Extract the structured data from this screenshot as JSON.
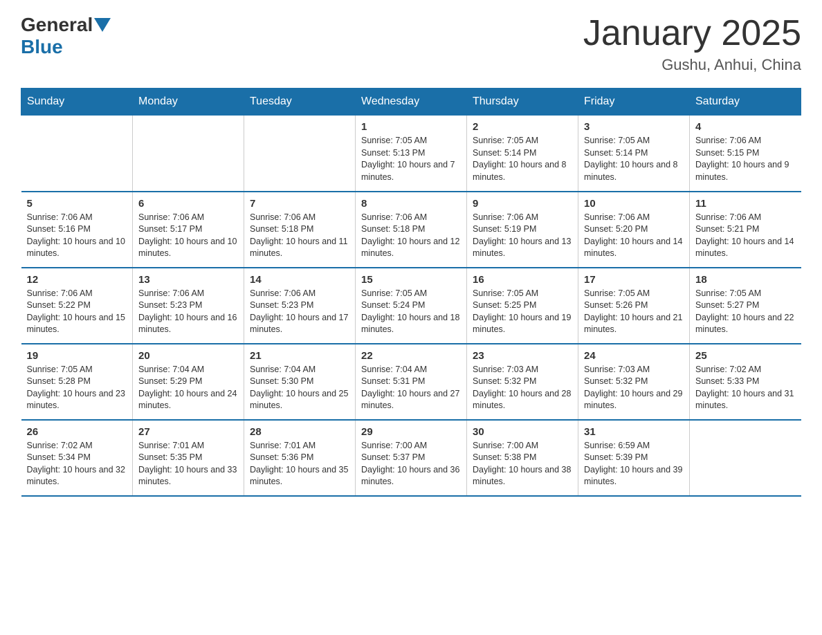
{
  "header": {
    "logo_general": "General",
    "logo_blue": "Blue",
    "month_title": "January 2025",
    "location": "Gushu, Anhui, China"
  },
  "days_of_week": [
    "Sunday",
    "Monday",
    "Tuesday",
    "Wednesday",
    "Thursday",
    "Friday",
    "Saturday"
  ],
  "weeks": [
    [
      {
        "day": "",
        "info": ""
      },
      {
        "day": "",
        "info": ""
      },
      {
        "day": "",
        "info": ""
      },
      {
        "day": "1",
        "info": "Sunrise: 7:05 AM\nSunset: 5:13 PM\nDaylight: 10 hours and 7 minutes."
      },
      {
        "day": "2",
        "info": "Sunrise: 7:05 AM\nSunset: 5:14 PM\nDaylight: 10 hours and 8 minutes."
      },
      {
        "day": "3",
        "info": "Sunrise: 7:05 AM\nSunset: 5:14 PM\nDaylight: 10 hours and 8 minutes."
      },
      {
        "day": "4",
        "info": "Sunrise: 7:06 AM\nSunset: 5:15 PM\nDaylight: 10 hours and 9 minutes."
      }
    ],
    [
      {
        "day": "5",
        "info": "Sunrise: 7:06 AM\nSunset: 5:16 PM\nDaylight: 10 hours and 10 minutes."
      },
      {
        "day": "6",
        "info": "Sunrise: 7:06 AM\nSunset: 5:17 PM\nDaylight: 10 hours and 10 minutes."
      },
      {
        "day": "7",
        "info": "Sunrise: 7:06 AM\nSunset: 5:18 PM\nDaylight: 10 hours and 11 minutes."
      },
      {
        "day": "8",
        "info": "Sunrise: 7:06 AM\nSunset: 5:18 PM\nDaylight: 10 hours and 12 minutes."
      },
      {
        "day": "9",
        "info": "Sunrise: 7:06 AM\nSunset: 5:19 PM\nDaylight: 10 hours and 13 minutes."
      },
      {
        "day": "10",
        "info": "Sunrise: 7:06 AM\nSunset: 5:20 PM\nDaylight: 10 hours and 14 minutes."
      },
      {
        "day": "11",
        "info": "Sunrise: 7:06 AM\nSunset: 5:21 PM\nDaylight: 10 hours and 14 minutes."
      }
    ],
    [
      {
        "day": "12",
        "info": "Sunrise: 7:06 AM\nSunset: 5:22 PM\nDaylight: 10 hours and 15 minutes."
      },
      {
        "day": "13",
        "info": "Sunrise: 7:06 AM\nSunset: 5:23 PM\nDaylight: 10 hours and 16 minutes."
      },
      {
        "day": "14",
        "info": "Sunrise: 7:06 AM\nSunset: 5:23 PM\nDaylight: 10 hours and 17 minutes."
      },
      {
        "day": "15",
        "info": "Sunrise: 7:05 AM\nSunset: 5:24 PM\nDaylight: 10 hours and 18 minutes."
      },
      {
        "day": "16",
        "info": "Sunrise: 7:05 AM\nSunset: 5:25 PM\nDaylight: 10 hours and 19 minutes."
      },
      {
        "day": "17",
        "info": "Sunrise: 7:05 AM\nSunset: 5:26 PM\nDaylight: 10 hours and 21 minutes."
      },
      {
        "day": "18",
        "info": "Sunrise: 7:05 AM\nSunset: 5:27 PM\nDaylight: 10 hours and 22 minutes."
      }
    ],
    [
      {
        "day": "19",
        "info": "Sunrise: 7:05 AM\nSunset: 5:28 PM\nDaylight: 10 hours and 23 minutes."
      },
      {
        "day": "20",
        "info": "Sunrise: 7:04 AM\nSunset: 5:29 PM\nDaylight: 10 hours and 24 minutes."
      },
      {
        "day": "21",
        "info": "Sunrise: 7:04 AM\nSunset: 5:30 PM\nDaylight: 10 hours and 25 minutes."
      },
      {
        "day": "22",
        "info": "Sunrise: 7:04 AM\nSunset: 5:31 PM\nDaylight: 10 hours and 27 minutes."
      },
      {
        "day": "23",
        "info": "Sunrise: 7:03 AM\nSunset: 5:32 PM\nDaylight: 10 hours and 28 minutes."
      },
      {
        "day": "24",
        "info": "Sunrise: 7:03 AM\nSunset: 5:32 PM\nDaylight: 10 hours and 29 minutes."
      },
      {
        "day": "25",
        "info": "Sunrise: 7:02 AM\nSunset: 5:33 PM\nDaylight: 10 hours and 31 minutes."
      }
    ],
    [
      {
        "day": "26",
        "info": "Sunrise: 7:02 AM\nSunset: 5:34 PM\nDaylight: 10 hours and 32 minutes."
      },
      {
        "day": "27",
        "info": "Sunrise: 7:01 AM\nSunset: 5:35 PM\nDaylight: 10 hours and 33 minutes."
      },
      {
        "day": "28",
        "info": "Sunrise: 7:01 AM\nSunset: 5:36 PM\nDaylight: 10 hours and 35 minutes."
      },
      {
        "day": "29",
        "info": "Sunrise: 7:00 AM\nSunset: 5:37 PM\nDaylight: 10 hours and 36 minutes."
      },
      {
        "day": "30",
        "info": "Sunrise: 7:00 AM\nSunset: 5:38 PM\nDaylight: 10 hours and 38 minutes."
      },
      {
        "day": "31",
        "info": "Sunrise: 6:59 AM\nSunset: 5:39 PM\nDaylight: 10 hours and 39 minutes."
      },
      {
        "day": "",
        "info": ""
      }
    ]
  ]
}
